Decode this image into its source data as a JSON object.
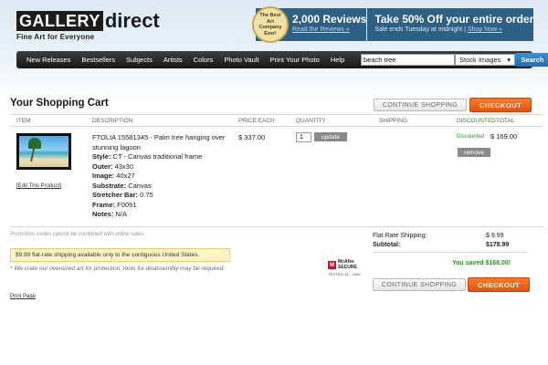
{
  "header": {
    "logo_gallery": "GALLERY",
    "logo_direct": "direct",
    "tagline": "Fine Art for Everyone",
    "badge_text": "The Best Art Company Ever!",
    "reviews_title": "2,000 Reviews",
    "reviews_link": "Read the Reviews »",
    "promo_title": "Take 50% Off your entire order",
    "promo_sub": "Sale ends Tuesday at midnight",
    "promo_link": "Shop Now »"
  },
  "nav": {
    "items": [
      "New Releases",
      "Bestsellers",
      "Subjects",
      "Artists",
      "Colors",
      "Photo Vault",
      "Print Your Photo",
      "Help"
    ],
    "search_value": "beach tree",
    "search_category": "Stock Images",
    "search_button": "Search"
  },
  "cart": {
    "title": "Your Shopping Cart",
    "continue_label": "CONTINUE SHOPPING",
    "checkout_label": "CHECKOUT",
    "columns": {
      "item": "ITEM",
      "description": "DESCRIPTION",
      "price": "PRICE EACH",
      "quantity": "QUANTITY",
      "shipping": "SHIPPING",
      "discounted": "DISCOUNTED",
      "total": "TOTAL"
    },
    "item": {
      "edit_link": "[Edit This Product]",
      "name": "FTOLIA 15581345 - Palm tree hanging over stunning lagoon",
      "specs": [
        {
          "label": "Style:",
          "value": "CT - Canvas traditional frame"
        },
        {
          "label": "Outer:",
          "value": "43x30"
        },
        {
          "label": "Image:",
          "value": "40x27"
        },
        {
          "label": "Substrate:",
          "value": "Canvas"
        },
        {
          "label": "Stretcher Bar:",
          "value": "0.75"
        },
        {
          "label": "Frame:",
          "value": "F0091"
        },
        {
          "label": "Notes:",
          "value": "N/A"
        }
      ],
      "price": "$ 337.00",
      "quantity": "1",
      "update_label": "update",
      "discounted_label": "Discounted",
      "total": "$ 169.00",
      "remove_label": "remove"
    },
    "promo_note": "Promotion codes cannot be combined with online sales.",
    "ship_notice": "$9.99 flat-rate shipping available only to the contiguous United States.",
    "crate_note": "* We crate our oversized art for protection; tools for disassembly may be required.",
    "print_link": "Print Page",
    "mcafee": {
      "logo": "M",
      "line1": "McAfee",
      "line2": "SECURE",
      "tested": "TESTED 31 - MAY"
    },
    "summary": {
      "shipping_label": "Flat Rate Shipping:",
      "shipping_value": "$ 9.99",
      "subtotal_label": "Subtotal:",
      "subtotal_value": "$178.99",
      "saved": "You saved $168.00!"
    }
  }
}
